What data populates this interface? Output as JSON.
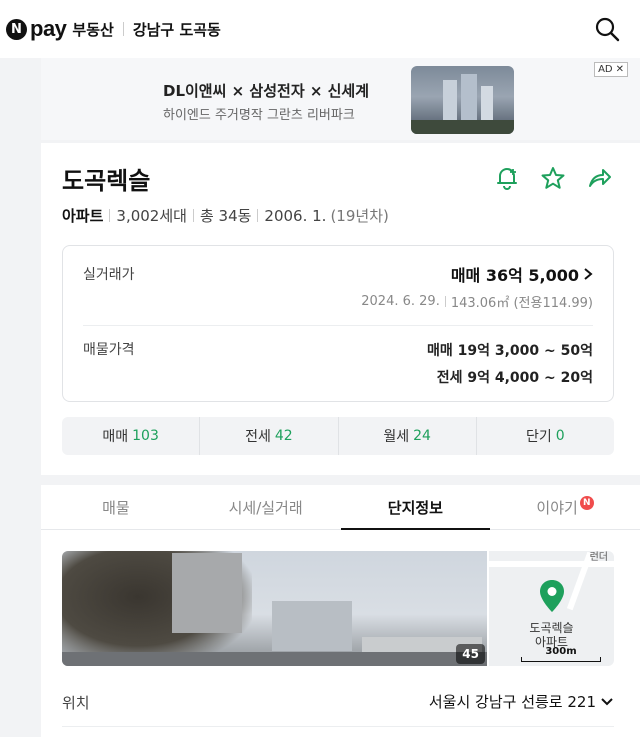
{
  "header": {
    "logo_n": "N",
    "logo_pay": "pay",
    "service": "부동산",
    "region": "강남구 도곡동"
  },
  "ad": {
    "title": "DL이앤씨 × 삼성전자 × 신세계",
    "subtitle": "하이엔드 주거명작 그란츠 리버파크",
    "badge": "AD",
    "close": "✕"
  },
  "complex": {
    "name": "도곡렉슬",
    "type": "아파트",
    "households": "3,002세대",
    "buildings": "총 34동",
    "completed": "2006. 1.",
    "age": "(19년차)"
  },
  "price": {
    "actual_label": "실거래가",
    "actual_value": "매매 36억 5,000",
    "actual_date": "2024. 6. 29.",
    "actual_area": "143.06㎡ (전용114.99)",
    "listing_label": "매물가격",
    "listing_sale": "매매 19억 3,000 ~ 50억",
    "listing_jeonse": "전세 9억 4,000 ~ 20억"
  },
  "counts": [
    {
      "label": "매매",
      "value": "103"
    },
    {
      "label": "전세",
      "value": "42"
    },
    {
      "label": "월세",
      "value": "24"
    },
    {
      "label": "단기",
      "value": "0"
    }
  ],
  "tabs": [
    {
      "label": "매물"
    },
    {
      "label": "시세/실거래"
    },
    {
      "label": "단지정보"
    },
    {
      "label": "이야기"
    }
  ],
  "new_badge": "N",
  "photo": {
    "count": "45"
  },
  "map": {
    "top_text": "런더",
    "label_name": "도곡렉슬",
    "label_type": "아파트",
    "scale": "300m"
  },
  "location": {
    "label": "위치",
    "value": "서울시 강남구 선릉로 221"
  },
  "colors": {
    "accent_green": "#1ea05c",
    "new_badge_red": "#f04c4c"
  }
}
